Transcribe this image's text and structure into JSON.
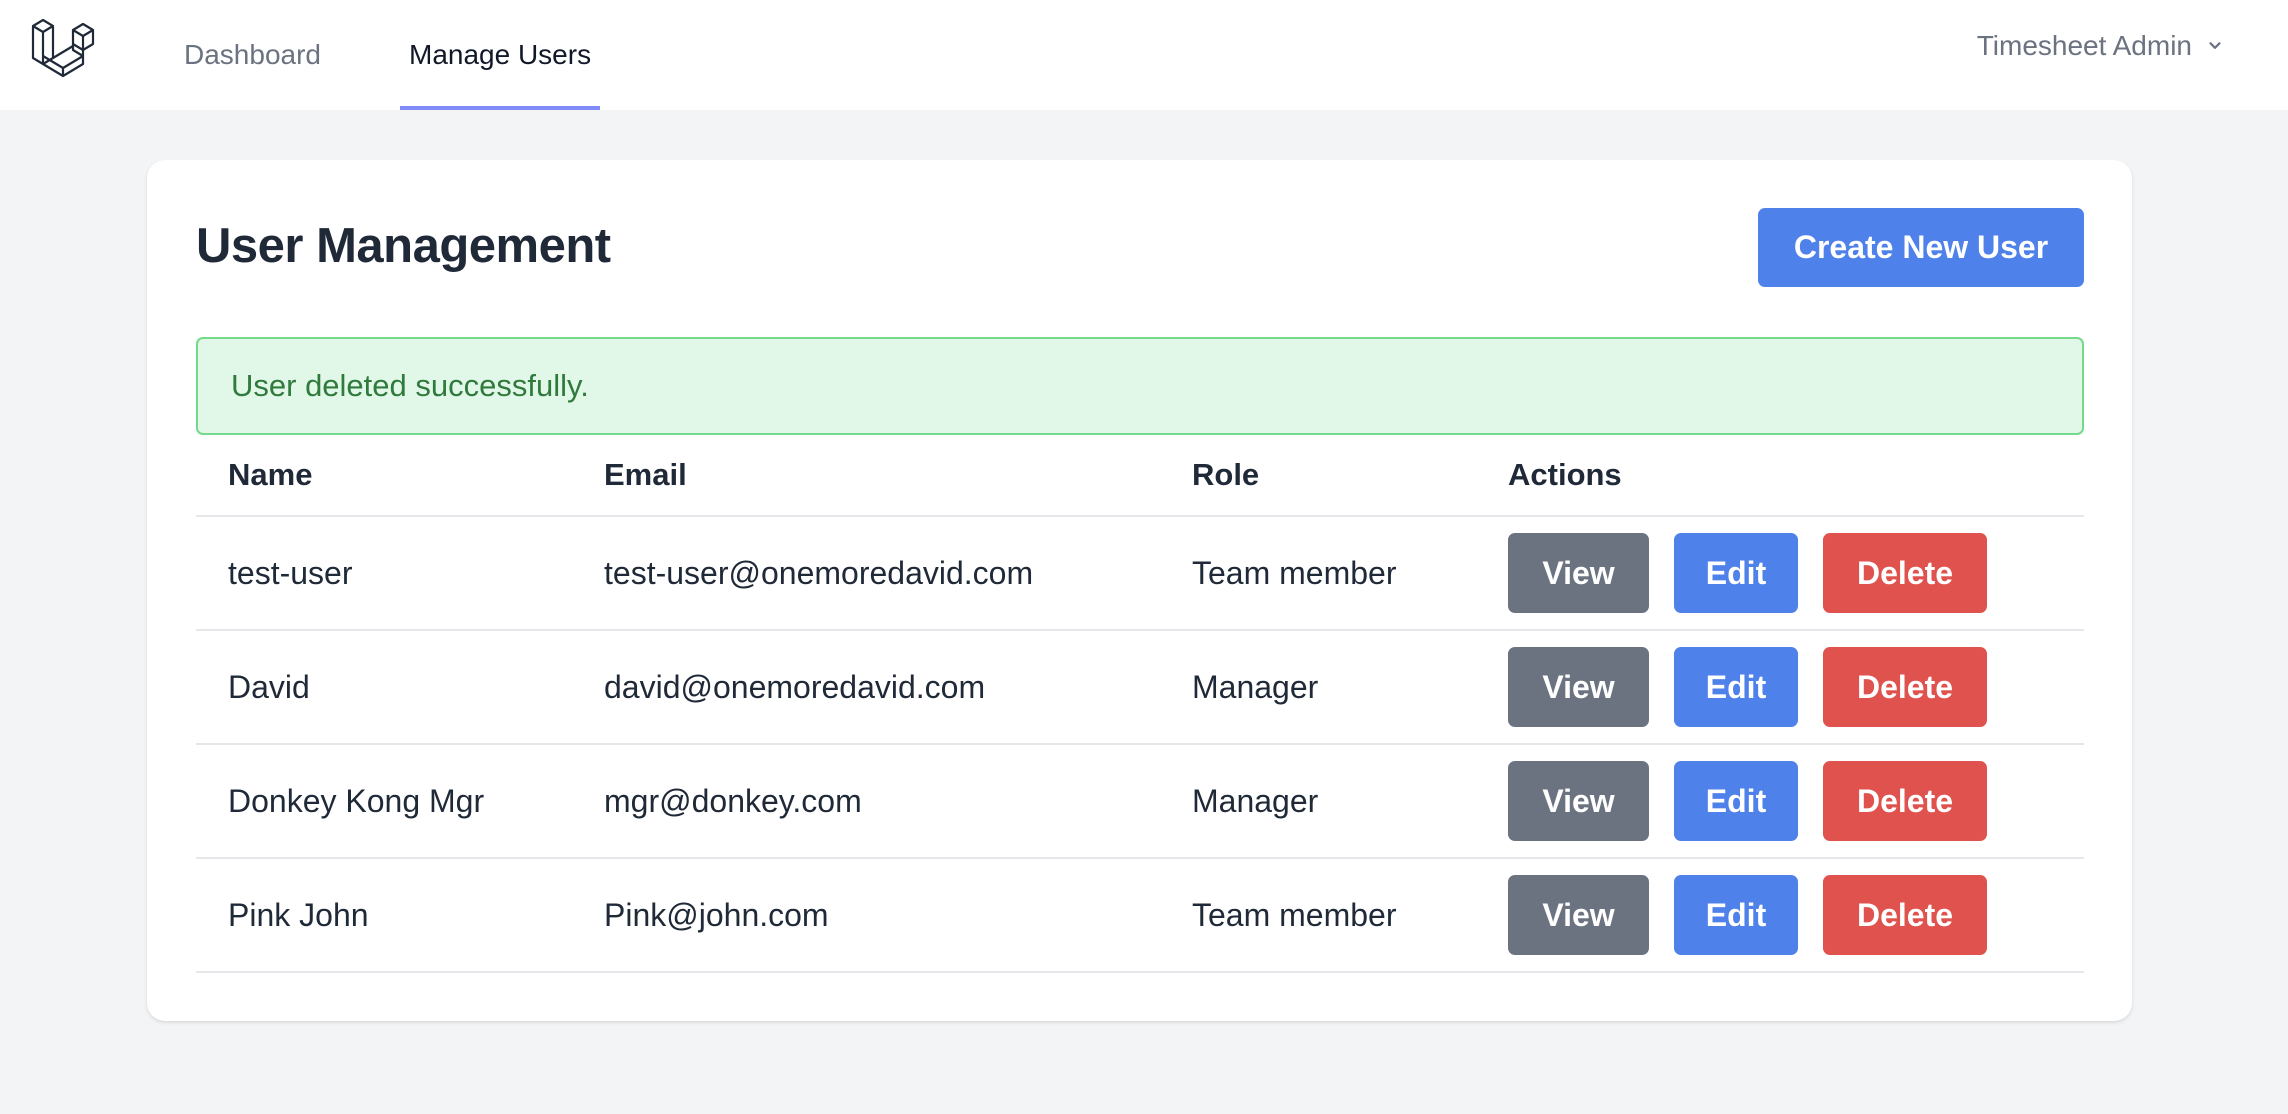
{
  "nav": {
    "logo": "laravel-logo-icon",
    "links": [
      {
        "label": "Dashboard",
        "active": false
      },
      {
        "label": "Manage Users",
        "active": true
      }
    ],
    "user_menu": {
      "label": "Timesheet Admin",
      "icon": "chevron-down-icon"
    }
  },
  "page": {
    "title": "User Management",
    "create_button": "Create New User",
    "alert": {
      "message": "User deleted successfully.",
      "type": "success"
    }
  },
  "table": {
    "columns": [
      "Name",
      "Email",
      "Role",
      "Actions"
    ],
    "rows": [
      {
        "name": "test-user",
        "email": "test-user@onemoredavid.com",
        "role": "Team member",
        "actions": [
          "View",
          "Edit",
          "Delete"
        ]
      },
      {
        "name": "David",
        "email": "david@onemoredavid.com",
        "role": "Manager",
        "actions": [
          "View",
          "Edit",
          "Delete"
        ]
      },
      {
        "name": "Donkey Kong Mgr",
        "email": "mgr@donkey.com",
        "role": "Manager",
        "actions": [
          "View",
          "Edit",
          "Delete"
        ]
      },
      {
        "name": "Pink John",
        "email": "Pink@john.com",
        "role": "Team member",
        "actions": [
          "View",
          "Edit",
          "Delete"
        ]
      }
    ]
  },
  "colors": {
    "primary": "#4f81ea",
    "secondary": "#6b7280",
    "danger": "#e0524d",
    "success_bg": "#e1f8e8",
    "success_border": "#74d98a",
    "success_text": "#2f7a3c",
    "nav_active_underline": "#818cf8"
  }
}
